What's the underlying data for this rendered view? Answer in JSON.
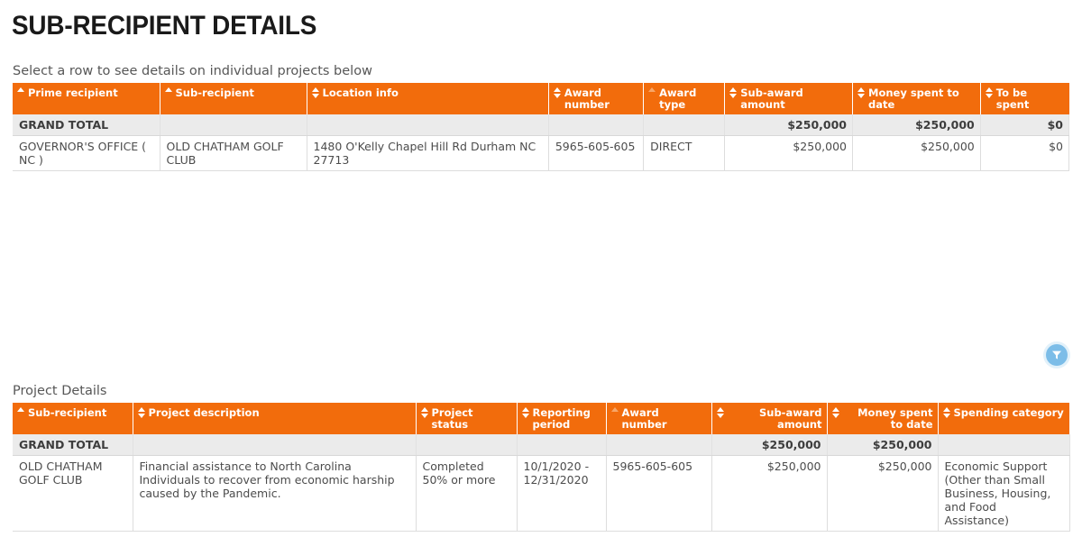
{
  "header": {
    "title": "SUB-RECIPIENT DETAILS",
    "caption": "Select a row to see details on individual projects below"
  },
  "colors": {
    "header_orange": "#F26C0C",
    "total_row_grey": "#EBEBEB",
    "filter_blue": "#7CBDE8",
    "text_grey": "#4C4C4C"
  },
  "subrecipient_table": {
    "columns": [
      {
        "label": "Prime recipient",
        "sort": "asc",
        "align": "left"
      },
      {
        "label": "Sub-recipient",
        "sort": "asc",
        "align": "left"
      },
      {
        "label": "Location info",
        "sort": "both",
        "align": "left"
      },
      {
        "label": "Award number",
        "sort": "both",
        "align": "left"
      },
      {
        "label": "Award type",
        "sort": "dim-asc",
        "align": "left"
      },
      {
        "label": "Sub-award amount",
        "sort": "both",
        "align": "left"
      },
      {
        "label": "Money spent to date",
        "sort": "both",
        "align": "left"
      },
      {
        "label": "To be spent",
        "sort": "both",
        "align": "left"
      }
    ],
    "total_row": {
      "label": "GRAND TOTAL",
      "sub_award_amount": "$250,000",
      "money_spent_to_date": "$250,000",
      "to_be_spent": "$0"
    },
    "rows": [
      {
        "prime_recipient": "GOVERNOR'S OFFICE ( NC )",
        "sub_recipient": "OLD CHATHAM GOLF CLUB",
        "location_info": "1480 O'Kelly Chapel Hill Rd Durham NC 27713",
        "award_number": "5965-605-605",
        "award_type": "DIRECT",
        "sub_award_amount": "$250,000",
        "money_spent_to_date": "$250,000",
        "to_be_spent": "$0"
      }
    ]
  },
  "filter_icon": {
    "name": "filter-icon",
    "tooltip": "Filter"
  },
  "project_section": {
    "label": "Project Details",
    "columns": [
      {
        "label": "Sub-recipient",
        "sort": "asc",
        "align": "left"
      },
      {
        "label": "Project description",
        "sort": "both",
        "align": "left"
      },
      {
        "label": "Project status",
        "sort": "both",
        "align": "left"
      },
      {
        "label": "Reporting period",
        "sort": "both",
        "align": "left"
      },
      {
        "label": "Award number",
        "sort": "dim-asc",
        "align": "left"
      },
      {
        "label": "Sub-award amount",
        "sort": "both",
        "align": "right"
      },
      {
        "label": "Money spent to date",
        "sort": "both",
        "align": "right"
      },
      {
        "label": "Spending category",
        "sort": "both",
        "align": "left"
      }
    ],
    "total_row": {
      "label": "GRAND TOTAL",
      "sub_award_amount": "$250,000",
      "money_spent_to_date": "$250,000"
    },
    "rows": [
      {
        "sub_recipient": "OLD CHATHAM GOLF CLUB",
        "project_description": "Financial assistance to North Carolina Individuals to recover from economic harship caused by the Pandemic.",
        "project_status": "Completed 50% or more",
        "reporting_period": "10/1/2020 - 12/31/2020",
        "award_number": "5965-605-605",
        "sub_award_amount": "$250,000",
        "money_spent_to_date": "$250,000",
        "spending_category": "Economic Support (Other than Small Business, Housing, and Food Assistance)"
      }
    ]
  }
}
